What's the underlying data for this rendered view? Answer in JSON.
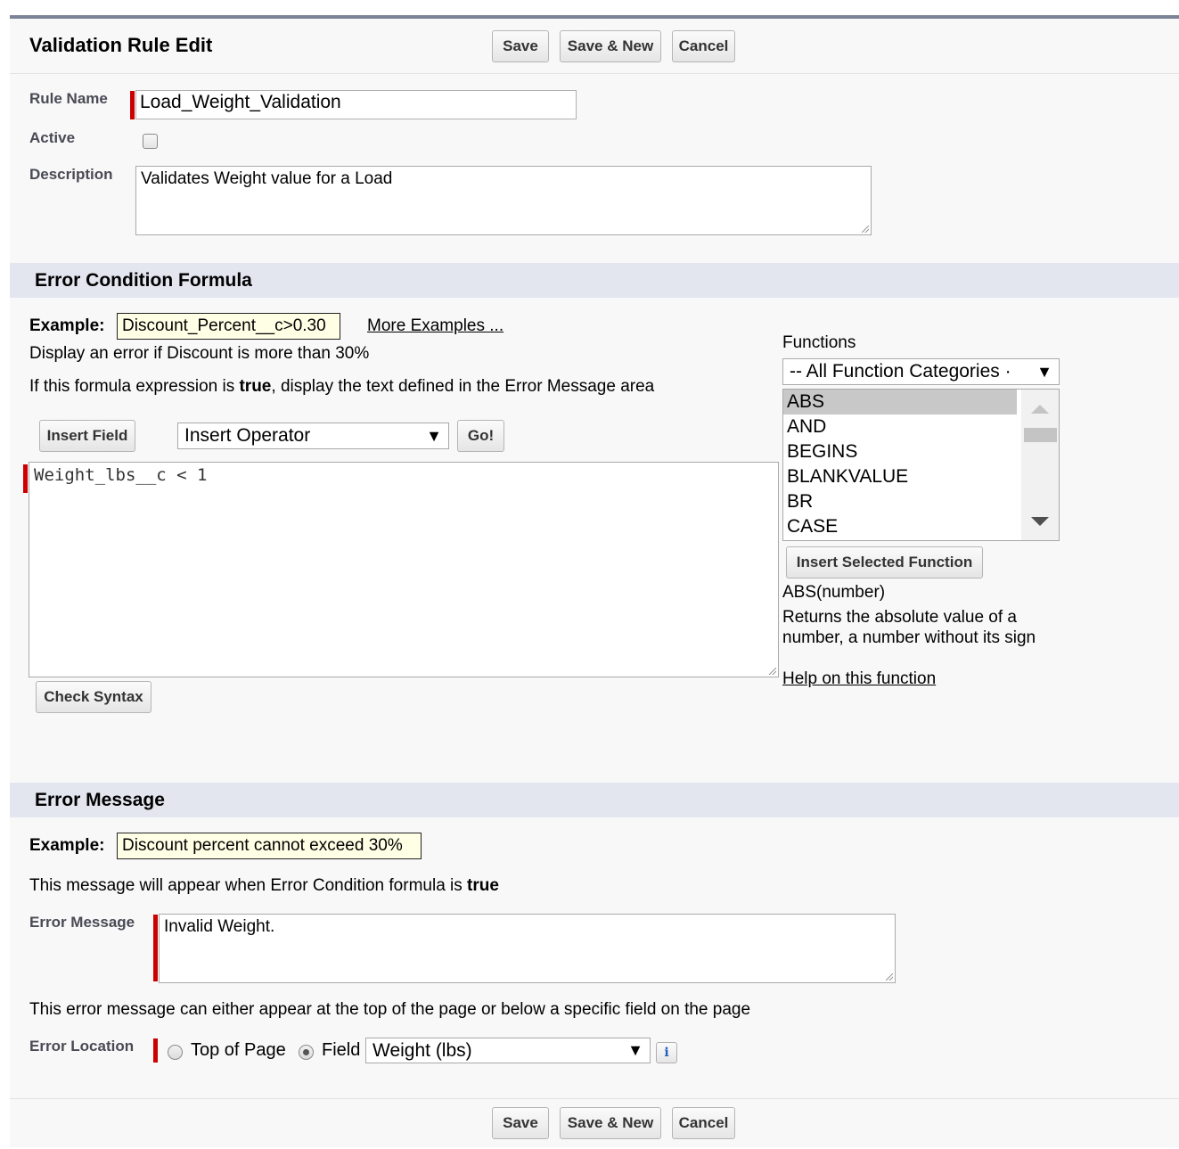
{
  "header": {
    "title": "Validation Rule Edit",
    "save_label": "Save",
    "save_new_label": "Save & New",
    "cancel_label": "Cancel"
  },
  "rule": {
    "name_label": "Rule Name",
    "name_value": "Load_Weight_Validation",
    "active_label": "Active",
    "active_checked": false,
    "description_label": "Description",
    "description_value": "Validates Weight value for a Load"
  },
  "formula_section": {
    "title": "Error Condition Formula",
    "example_label": "Example:",
    "example_value": "Discount_Percent__c>0.30",
    "more_examples": "More Examples ...",
    "example_desc": "Display an error if Discount is more than 30%",
    "instruction_pre": "If this formula expression is ",
    "instruction_bold": "true",
    "instruction_post": ", display the text defined in the Error Message area",
    "insert_field_label": "Insert Field",
    "insert_operator_label": "Insert Operator",
    "go_label": "Go!",
    "formula_value": "Weight_lbs__c < 1",
    "check_syntax_label": "Check Syntax"
  },
  "functions": {
    "label": "Functions",
    "category_selected": "-- All Function Categories ·",
    "items": [
      "ABS",
      "AND",
      "BEGINS",
      "BLANKVALUE",
      "BR",
      "CASE"
    ],
    "selected": "ABS",
    "insert_selected_label": "Insert Selected Function",
    "signature": "ABS(number)",
    "desc_line1": "Returns the absolute value of a",
    "desc_line2": "number, a number without its sign",
    "help_link": "Help on this function"
  },
  "message_section": {
    "title": "Error Message",
    "example_label": "Example:",
    "example_value": "Discount percent cannot exceed 30%",
    "info_pre": "This message will appear when Error Condition formula is ",
    "info_bold": "true",
    "error_message_label": "Error Message",
    "error_message_value": "Invalid Weight.",
    "location_info": "This error message can either appear at the top of the page or below a specific field on the page",
    "location_label": "Error Location",
    "top_of_page_label": "Top of Page",
    "field_label": "Field",
    "field_selected": "Weight (lbs)",
    "info_icon": "i"
  },
  "footer": {
    "save_label": "Save",
    "save_new_label": "Save & New",
    "cancel_label": "Cancel"
  },
  "colors": {
    "required_bar": "#cc0000",
    "section_bg": "#e3e6ef",
    "example_bg": "#ffffe5",
    "panel_border": "#7b8496"
  }
}
